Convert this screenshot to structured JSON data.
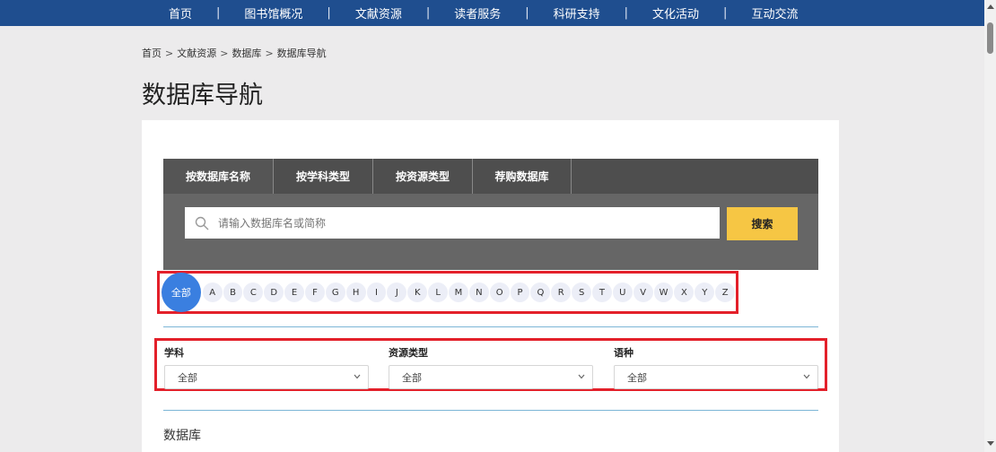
{
  "nav": {
    "items": [
      "首页",
      "图书馆概况",
      "文献资源",
      "读者服务",
      "科研支持",
      "文化活动",
      "互动交流"
    ],
    "separator": "|"
  },
  "breadcrumb": {
    "items": [
      "首页",
      "文献资源",
      "数据库",
      "数据库导航"
    ],
    "separator": ">"
  },
  "page": {
    "title": "数据库导航"
  },
  "search": {
    "tabs": [
      "按数据库名称",
      "按学科类型",
      "按资源类型",
      "荐购数据库"
    ],
    "active_tab": 0,
    "placeholder": "请输入数据库名或简称",
    "button": "搜索"
  },
  "alphabet": {
    "all": "全部",
    "letters": [
      "A",
      "B",
      "C",
      "D",
      "E",
      "F",
      "G",
      "H",
      "I",
      "J",
      "K",
      "L",
      "M",
      "N",
      "O",
      "P",
      "Q",
      "R",
      "S",
      "T",
      "U",
      "V",
      "W",
      "X",
      "Y",
      "Z"
    ]
  },
  "filters": [
    {
      "label": "学科",
      "value": "全部"
    },
    {
      "label": "资源类型",
      "value": "全部"
    },
    {
      "label": "语种",
      "value": "全部"
    }
  ],
  "section": {
    "heading": "数据库"
  },
  "colors": {
    "nav_bg": "#1f4e8f",
    "search_btn": "#f6c644",
    "all_letter": "#3a7fe0",
    "highlight": "#e3202a"
  }
}
